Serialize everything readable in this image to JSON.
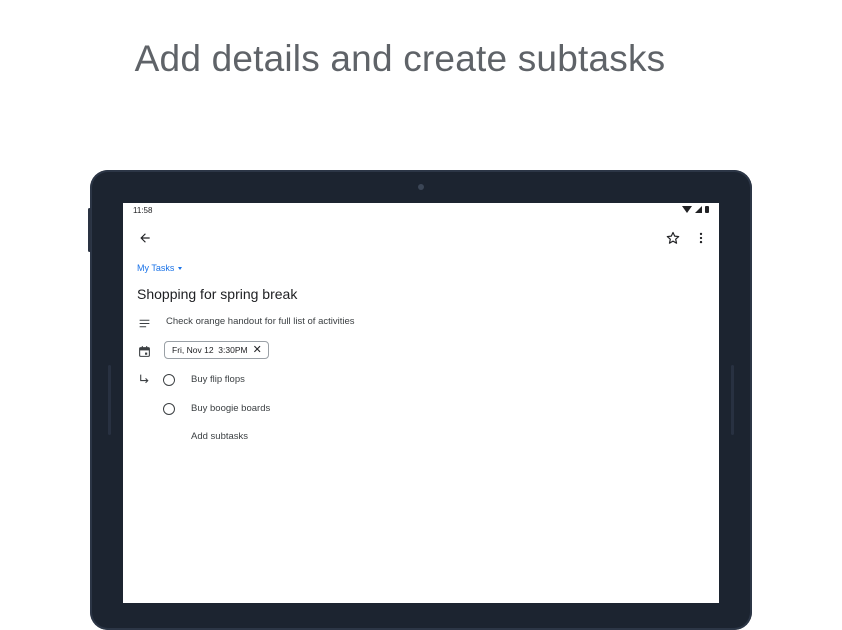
{
  "headline": "Add details and create subtasks",
  "status_bar": {
    "time": "11:58"
  },
  "icons": {
    "back": "arrow-back-icon",
    "star": "star-outline-icon",
    "more": "more-vert-icon",
    "details": "notes-icon",
    "date": "calendar-icon",
    "subtask": "subdirectory-arrow-icon"
  },
  "task": {
    "list_name": "My Tasks",
    "title": "Shopping for spring break",
    "details": "Check orange handout for full list of activities",
    "due": "Fri, Nov 12  3:30PM",
    "subtasks": [
      "Buy flip flops",
      "Buy boogie boards"
    ],
    "add_subtasks_label": "Add subtasks"
  },
  "colors": {
    "accent": "#1a73e8",
    "headline": "#5f6368",
    "device": "#1c2430"
  }
}
